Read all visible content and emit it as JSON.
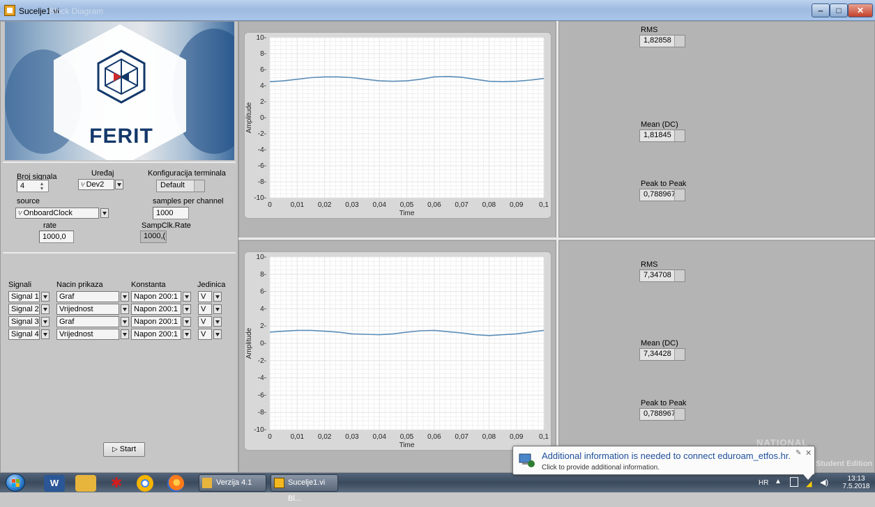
{
  "window": {
    "title": "Sucelje1.vi",
    "ghost_title": "Block Diagram"
  },
  "logo": {
    "text": "FERIT"
  },
  "config": {
    "broj_signala_label": "Broj signala",
    "broj_signala_value": "4",
    "uredaj_label": "Uređaj",
    "uredaj_value": "Dev2",
    "konfig_label": "Konfiguracija terminala",
    "konfig_value": "Default",
    "source_label": "source",
    "source_value": "OnboardClock",
    "spc_label": "samples per channel",
    "spc_value": "1000",
    "rate_label": "rate",
    "rate_value": "1000,0",
    "sampclk_label": "SampClk.Rate",
    "sampclk_value": "1000,("
  },
  "signals": {
    "headers": [
      "Signali",
      "Nacin prikaza",
      "Konstanta",
      "Jedinica"
    ],
    "rows": [
      {
        "signal": "Signal 1",
        "mode": "Graf",
        "const": "Napon 200:1",
        "unit": "V"
      },
      {
        "signal": "Signal 2",
        "mode": "Vrijednost",
        "const": "Napon 200:1",
        "unit": "V"
      },
      {
        "signal": "Signal 3",
        "mode": "Graf",
        "const": "Napon 200:1",
        "unit": "V"
      },
      {
        "signal": "Signal 4",
        "mode": "Vrijednost",
        "const": "Napon 200:1",
        "unit": "V"
      }
    ],
    "start_label": "Start"
  },
  "stats_top": {
    "rms_label": "RMS",
    "rms_value": "1,82858",
    "mean_label": "Mean (DC)",
    "mean_value": "1,81845",
    "p2p_label": "Peak to Peak",
    "p2p_value": "0,788967"
  },
  "stats_bottom": {
    "rms_label": "RMS",
    "rms_value": "7,34708",
    "mean_label": "Mean (DC)",
    "mean_value": "7,34428",
    "p2p_label": "Peak to Peak",
    "p2p_value": "0,788967"
  },
  "watermark": {
    "text": "NATIONAL",
    "edition": "Student Edition"
  },
  "notification": {
    "title": "Additional information is needed to connect eduroam_etfos.hr.",
    "subtitle": "Click to provide additional information."
  },
  "taskbar": {
    "task1": "Verzija 4.1",
    "task2": "Sucelje1.vi Bl...",
    "lang": "HR",
    "time": "13:13",
    "date": "7.5.2018"
  },
  "colors": {
    "line": "#5b8db8",
    "grid": "#e6e6e6",
    "panel": "#c6c6c6"
  },
  "chart_data": [
    {
      "type": "line",
      "title": "",
      "xlabel": "Time",
      "ylabel": "Amplitude",
      "xlim": [
        0,
        0.1
      ],
      "ylim": [
        -10,
        10
      ],
      "xticks": [
        "0",
        "0,01",
        "0,02",
        "0,03",
        "0,04",
        "0,05",
        "0,06",
        "0,07",
        "0,08",
        "0,09",
        "0,1"
      ],
      "yticks": [
        "10",
        "8",
        "6",
        "4",
        "2",
        "0",
        "-2",
        "-4",
        "-6",
        "-8",
        "-10"
      ],
      "series": [
        {
          "x": [
            0,
            0.005,
            0.01,
            0.015,
            0.02,
            0.025,
            0.03,
            0.035,
            0.04,
            0.045,
            0.05,
            0.055,
            0.06,
            0.065,
            0.07,
            0.075,
            0.08,
            0.085,
            0.09,
            0.095,
            0.1
          ],
          "y": [
            4.5,
            4.6,
            4.8,
            5.0,
            5.1,
            5.1,
            5.0,
            4.8,
            4.6,
            4.55,
            4.6,
            4.8,
            5.1,
            5.15,
            5.05,
            4.8,
            4.55,
            4.5,
            4.55,
            4.7,
            4.9
          ]
        }
      ]
    },
    {
      "type": "line",
      "title": "",
      "xlabel": "Time",
      "ylabel": "Amplitude",
      "xlim": [
        0,
        0.1
      ],
      "ylim": [
        -10,
        10
      ],
      "xticks": [
        "0",
        "0,01",
        "0,02",
        "0,03",
        "0,04",
        "0,05",
        "0,06",
        "0,07",
        "0,08",
        "0,09",
        "0,1"
      ],
      "yticks": [
        "10",
        "8",
        "6",
        "4",
        "2",
        "0",
        "-2",
        "-4",
        "-6",
        "-8",
        "-10"
      ],
      "series": [
        {
          "x": [
            0,
            0.005,
            0.01,
            0.015,
            0.02,
            0.025,
            0.03,
            0.035,
            0.04,
            0.045,
            0.05,
            0.055,
            0.06,
            0.065,
            0.07,
            0.075,
            0.08,
            0.085,
            0.09,
            0.095,
            0.1
          ],
          "y": [
            1.3,
            1.4,
            1.5,
            1.5,
            1.4,
            1.3,
            1.1,
            1.05,
            1.0,
            1.1,
            1.3,
            1.45,
            1.5,
            1.35,
            1.2,
            1.0,
            0.9,
            1.0,
            1.1,
            1.3,
            1.5
          ]
        }
      ]
    }
  ]
}
